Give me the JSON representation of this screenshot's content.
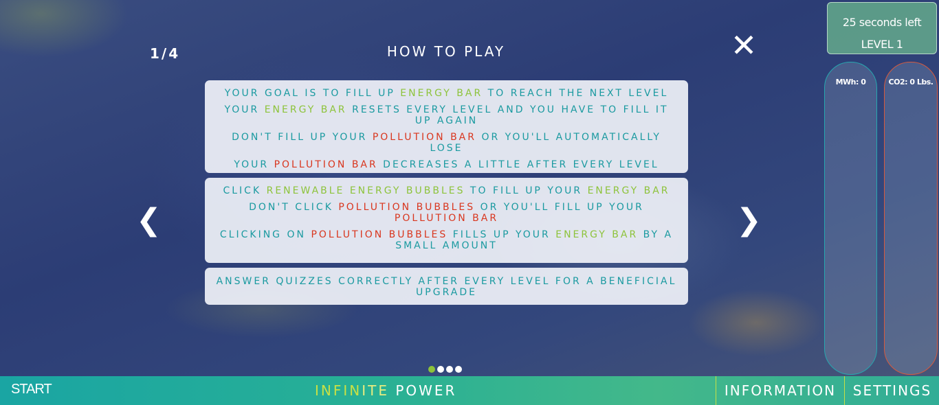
{
  "tutorial": {
    "page_counter": "1/4",
    "title": "HOW TO PLAY",
    "close_icon": "close-icon",
    "prev_icon": "chevron-left-icon",
    "next_icon": "chevron-right-icon",
    "card1": [
      [
        {
          "t": "Your goal is to fill up ",
          "c": "teal"
        },
        {
          "t": "energy bar",
          "c": "green"
        },
        {
          "t": " to reach the next level",
          "c": "teal"
        }
      ],
      [
        {
          "t": "Your ",
          "c": "teal"
        },
        {
          "t": "energy bar",
          "c": "green"
        },
        {
          "t": " resets every level and you have to fill it up again",
          "c": "teal"
        }
      ],
      [
        {
          "t": "Don't fill up your ",
          "c": "teal"
        },
        {
          "t": "pollution bar",
          "c": "red"
        },
        {
          "t": " or you'll automatically lose",
          "c": "teal"
        }
      ],
      [
        {
          "t": "Your ",
          "c": "teal"
        },
        {
          "t": "pollution bar",
          "c": "red"
        },
        {
          "t": " decreases a little after every level",
          "c": "teal"
        }
      ]
    ],
    "card2": [
      [
        {
          "t": "Click ",
          "c": "teal"
        },
        {
          "t": "renewable energy bubbles",
          "c": "green"
        },
        {
          "t": " to fill up your ",
          "c": "teal"
        },
        {
          "t": "energy bar",
          "c": "green"
        }
      ],
      [
        {
          "t": "Don't click ",
          "c": "teal"
        },
        {
          "t": "pollution bubbles",
          "c": "red"
        },
        {
          "t": " or you'll fill up your ",
          "c": "teal"
        },
        {
          "t": "pollution bar",
          "c": "red"
        }
      ],
      [
        {
          "t": "Clicking on ",
          "c": "teal"
        },
        {
          "t": "pollution bubbles",
          "c": "red"
        },
        {
          "t": " fills up your ",
          "c": "teal"
        },
        {
          "t": "energy bar",
          "c": "green"
        },
        {
          "t": " by a small amount",
          "c": "teal"
        }
      ]
    ],
    "card3": [
      [
        {
          "t": "Answer quizzes correctly after every level for a beneficial upgrade",
          "c": "teal"
        }
      ]
    ],
    "dots": {
      "total": 4,
      "active": 0
    }
  },
  "hud": {
    "timer": "25 seconds left",
    "level": "LEVEL 1",
    "energy_meter": {
      "label": "MWh: 0",
      "fill": 0
    },
    "co2_meter": {
      "label": "CO2: 0 Lbs.",
      "fill": 0
    }
  },
  "footer": {
    "start": "START",
    "brand_part1": "INFIN",
    "brand_part2": "ITE ",
    "brand_part3": "POWER",
    "information": "INFORMATION",
    "settings": "SETTINGS"
  },
  "colors": {
    "teal": "#1a9aa0",
    "green": "#8dc33a",
    "red": "#d9361e",
    "footer_accent": "#c8e045"
  }
}
